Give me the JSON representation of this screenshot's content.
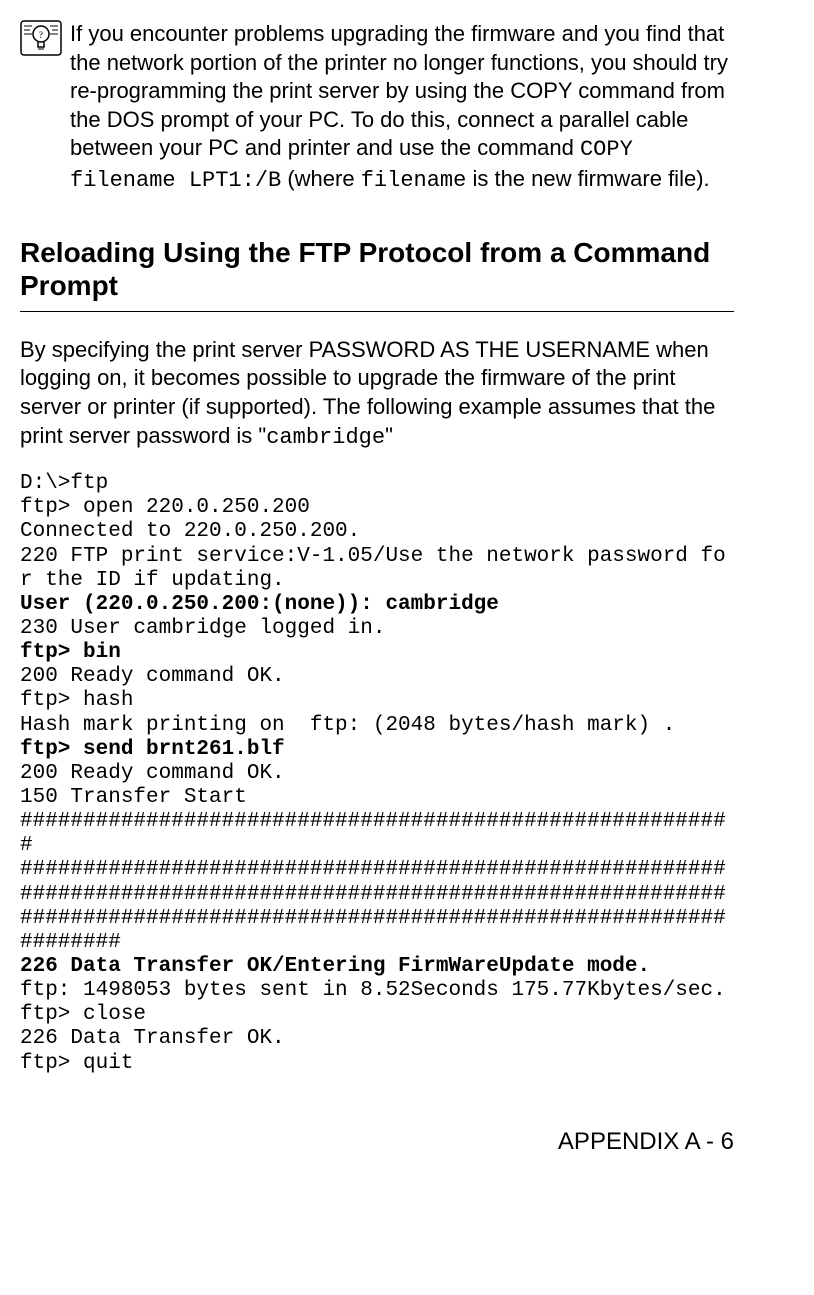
{
  "tip": {
    "text_pre": "If you encounter problems upgrading the firmware and you find that the network portion of the printer no longer functions, you should try re-programming the print server by using the COPY command from the DOS prompt of your PC. To do this, connect a parallel cable between your PC and printer and use the command ",
    "code1": "COPY filename LPT1:/B",
    "text_mid": " (where ",
    "code2": "filename",
    "text_post": " is the new firmware file)."
  },
  "heading": "Reloading Using the FTP Protocol from a Command Prompt",
  "intro": {
    "pre": "By specifying the print server PASSWORD AS THE USERNAME when logging on, it becomes possible to upgrade the firmware of the print server or printer (if supported). The following example assumes that the print server password is \"",
    "code": "cambridge",
    "post": "\""
  },
  "terminal": {
    "l1": "D:\\>ftp",
    "l2": "ftp> open 220.0.250.200",
    "l3": "Connected to 220.0.250.200.",
    "l4": "220 FTP print service:V-1.05/Use the network password for the ID if updating.",
    "l5": "User (220.0.250.200:(none)): cambridge",
    "l6": "230 User cambridge logged in.",
    "l7": "ftp> bin",
    "l8": "200 Ready command OK.",
    "l9": "ftp> hash",
    "l10": "Hash mark printing on  ftp: (2048 bytes/hash mark) .",
    "l11": "ftp> send brnt261.blf",
    "l12": "200 Ready command OK.",
    "l13": "150 Transfer Start",
    "l14": "#########################################################",
    "l15": "################################################################################################################################################################################",
    "l16": "226 Data Transfer OK/Entering FirmWareUpdate mode.",
    "l17": "ftp: 1498053 bytes sent in 8.52Seconds 175.77Kbytes/sec.",
    "l18": "ftp> close",
    "l19": "226 Data Transfer OK.",
    "l20": "ftp> quit"
  },
  "footer": "APPENDIX A - 6"
}
